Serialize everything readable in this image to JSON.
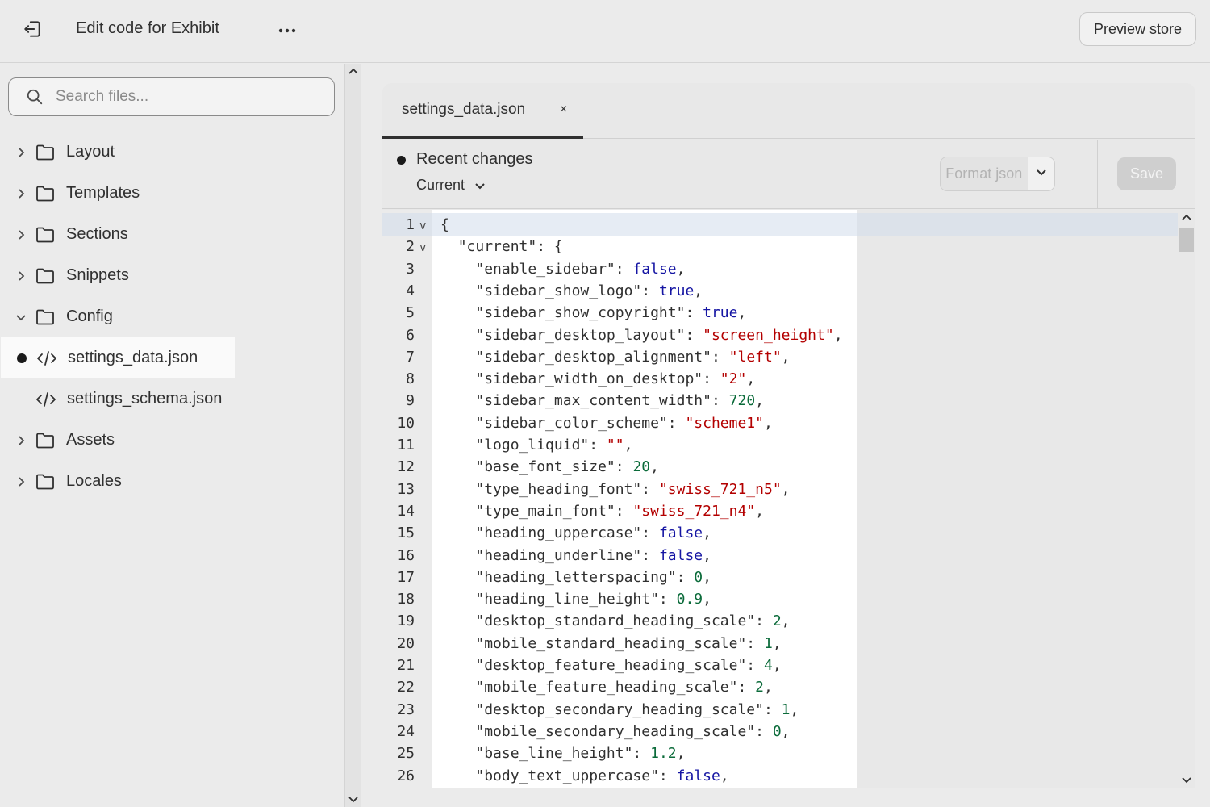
{
  "header": {
    "title": "Edit code for Exhibit",
    "preview_label": "Preview store"
  },
  "sidebar": {
    "search_placeholder": "Search files...",
    "items": [
      {
        "label": "Layout",
        "type": "folder",
        "expanded": false
      },
      {
        "label": "Templates",
        "type": "folder",
        "expanded": false
      },
      {
        "label": "Sections",
        "type": "folder",
        "expanded": false
      },
      {
        "label": "Snippets",
        "type": "folder",
        "expanded": false
      },
      {
        "label": "Config",
        "type": "folder",
        "expanded": true
      },
      {
        "label": "settings_data.json",
        "type": "file",
        "selected": true,
        "modified": true
      },
      {
        "label": "settings_schema.json",
        "type": "file"
      },
      {
        "label": "Assets",
        "type": "folder",
        "expanded": false
      },
      {
        "label": "Locales",
        "type": "folder",
        "expanded": false
      }
    ]
  },
  "editor": {
    "tab_label": "settings_data.json",
    "tab_close": "×",
    "recent_label": "Recent changes",
    "version_label": "Current",
    "format_label": "Format json",
    "save_label": "Save",
    "lines": [
      {
        "n": "1",
        "fold": "v",
        "indent": "",
        "tokens": [
          {
            "t": "{",
            "c": "key"
          }
        ]
      },
      {
        "n": "2",
        "fold": "v",
        "indent": "  ",
        "tokens": [
          {
            "t": "\"current\": {",
            "c": "key"
          }
        ]
      },
      {
        "n": "3",
        "indent": "    ",
        "tokens": [
          {
            "t": "\"enable_sidebar\": ",
            "c": "key"
          },
          {
            "t": "false",
            "c": "bool"
          },
          {
            "t": ",",
            "c": "key"
          }
        ]
      },
      {
        "n": "4",
        "indent": "    ",
        "tokens": [
          {
            "t": "\"sidebar_show_logo\": ",
            "c": "key"
          },
          {
            "t": "true",
            "c": "bool"
          },
          {
            "t": ",",
            "c": "key"
          }
        ]
      },
      {
        "n": "5",
        "indent": "    ",
        "tokens": [
          {
            "t": "\"sidebar_show_copyright\": ",
            "c": "key"
          },
          {
            "t": "true",
            "c": "bool"
          },
          {
            "t": ",",
            "c": "key"
          }
        ]
      },
      {
        "n": "6",
        "indent": "    ",
        "tokens": [
          {
            "t": "\"sidebar_desktop_layout\": ",
            "c": "key"
          },
          {
            "t": "\"screen_height\"",
            "c": "str"
          },
          {
            "t": ",",
            "c": "key"
          }
        ]
      },
      {
        "n": "7",
        "indent": "    ",
        "tokens": [
          {
            "t": "\"sidebar_desktop_alignment\": ",
            "c": "key"
          },
          {
            "t": "\"left\"",
            "c": "str"
          },
          {
            "t": ",",
            "c": "key"
          }
        ]
      },
      {
        "n": "8",
        "indent": "    ",
        "tokens": [
          {
            "t": "\"sidebar_width_on_desktop\": ",
            "c": "key"
          },
          {
            "t": "\"2\"",
            "c": "str"
          },
          {
            "t": ",",
            "c": "key"
          }
        ]
      },
      {
        "n": "9",
        "indent": "    ",
        "tokens": [
          {
            "t": "\"sidebar_max_content_width\": ",
            "c": "key"
          },
          {
            "t": "720",
            "c": "num"
          },
          {
            "t": ",",
            "c": "key"
          }
        ]
      },
      {
        "n": "10",
        "indent": "    ",
        "tokens": [
          {
            "t": "\"sidebar_color_scheme\": ",
            "c": "key"
          },
          {
            "t": "\"scheme1\"",
            "c": "str"
          },
          {
            "t": ",",
            "c": "key"
          }
        ]
      },
      {
        "n": "11",
        "indent": "    ",
        "tokens": [
          {
            "t": "\"logo_liquid\": ",
            "c": "key"
          },
          {
            "t": "\"\"",
            "c": "str"
          },
          {
            "t": ",",
            "c": "key"
          }
        ]
      },
      {
        "n": "12",
        "indent": "    ",
        "tokens": [
          {
            "t": "\"base_font_size\": ",
            "c": "key"
          },
          {
            "t": "20",
            "c": "num"
          },
          {
            "t": ",",
            "c": "key"
          }
        ]
      },
      {
        "n": "13",
        "indent": "    ",
        "tokens": [
          {
            "t": "\"type_heading_font\": ",
            "c": "key"
          },
          {
            "t": "\"swiss_721_n5\"",
            "c": "str"
          },
          {
            "t": ",",
            "c": "key"
          }
        ]
      },
      {
        "n": "14",
        "indent": "    ",
        "tokens": [
          {
            "t": "\"type_main_font\": ",
            "c": "key"
          },
          {
            "t": "\"swiss_721_n4\"",
            "c": "str"
          },
          {
            "t": ",",
            "c": "key"
          }
        ]
      },
      {
        "n": "15",
        "indent": "    ",
        "tokens": [
          {
            "t": "\"heading_uppercase\": ",
            "c": "key"
          },
          {
            "t": "false",
            "c": "bool"
          },
          {
            "t": ",",
            "c": "key"
          }
        ]
      },
      {
        "n": "16",
        "indent": "    ",
        "tokens": [
          {
            "t": "\"heading_underline\": ",
            "c": "key"
          },
          {
            "t": "false",
            "c": "bool"
          },
          {
            "t": ",",
            "c": "key"
          }
        ]
      },
      {
        "n": "17",
        "indent": "    ",
        "tokens": [
          {
            "t": "\"heading_letterspacing\": ",
            "c": "key"
          },
          {
            "t": "0",
            "c": "num"
          },
          {
            "t": ",",
            "c": "key"
          }
        ]
      },
      {
        "n": "18",
        "indent": "    ",
        "tokens": [
          {
            "t": "\"heading_line_height\": ",
            "c": "key"
          },
          {
            "t": "0.9",
            "c": "num"
          },
          {
            "t": ",",
            "c": "key"
          }
        ]
      },
      {
        "n": "19",
        "indent": "    ",
        "tokens": [
          {
            "t": "\"desktop_standard_heading_scale\": ",
            "c": "key"
          },
          {
            "t": "2",
            "c": "num"
          },
          {
            "t": ",",
            "c": "key"
          }
        ]
      },
      {
        "n": "20",
        "indent": "    ",
        "tokens": [
          {
            "t": "\"mobile_standard_heading_scale\": ",
            "c": "key"
          },
          {
            "t": "1",
            "c": "num"
          },
          {
            "t": ",",
            "c": "key"
          }
        ]
      },
      {
        "n": "21",
        "indent": "    ",
        "tokens": [
          {
            "t": "\"desktop_feature_heading_scale\": ",
            "c": "key"
          },
          {
            "t": "4",
            "c": "num"
          },
          {
            "t": ",",
            "c": "key"
          }
        ]
      },
      {
        "n": "22",
        "indent": "    ",
        "tokens": [
          {
            "t": "\"mobile_feature_heading_scale\": ",
            "c": "key"
          },
          {
            "t": "2",
            "c": "num"
          },
          {
            "t": ",",
            "c": "key"
          }
        ]
      },
      {
        "n": "23",
        "indent": "    ",
        "tokens": [
          {
            "t": "\"desktop_secondary_heading_scale\": ",
            "c": "key"
          },
          {
            "t": "1",
            "c": "num"
          },
          {
            "t": ",",
            "c": "key"
          }
        ]
      },
      {
        "n": "24",
        "indent": "    ",
        "tokens": [
          {
            "t": "\"mobile_secondary_heading_scale\": ",
            "c": "key"
          },
          {
            "t": "0",
            "c": "num"
          },
          {
            "t": ",",
            "c": "key"
          }
        ]
      },
      {
        "n": "25",
        "indent": "    ",
        "tokens": [
          {
            "t": "\"base_line_height\": ",
            "c": "key"
          },
          {
            "t": "1.2",
            "c": "num"
          },
          {
            "t": ",",
            "c": "key"
          }
        ]
      },
      {
        "n": "26",
        "indent": "    ",
        "tokens": [
          {
            "t": "\"body_text_uppercase\": ",
            "c": "key"
          },
          {
            "t": "false",
            "c": "bool"
          },
          {
            "t": ",",
            "c": "key"
          }
        ]
      }
    ]
  },
  "icons": {
    "exit": "exit-icon",
    "more": "more-horizontal-icon",
    "search": "search-icon",
    "folder": "folder-icon",
    "code": "code-icon",
    "chevron_right": "chevron-right-icon",
    "chevron_down": "chevron-down-icon"
  },
  "colors": {
    "bool": "#1515a3",
    "string": "#b30000",
    "number": "#0b6b3a"
  }
}
